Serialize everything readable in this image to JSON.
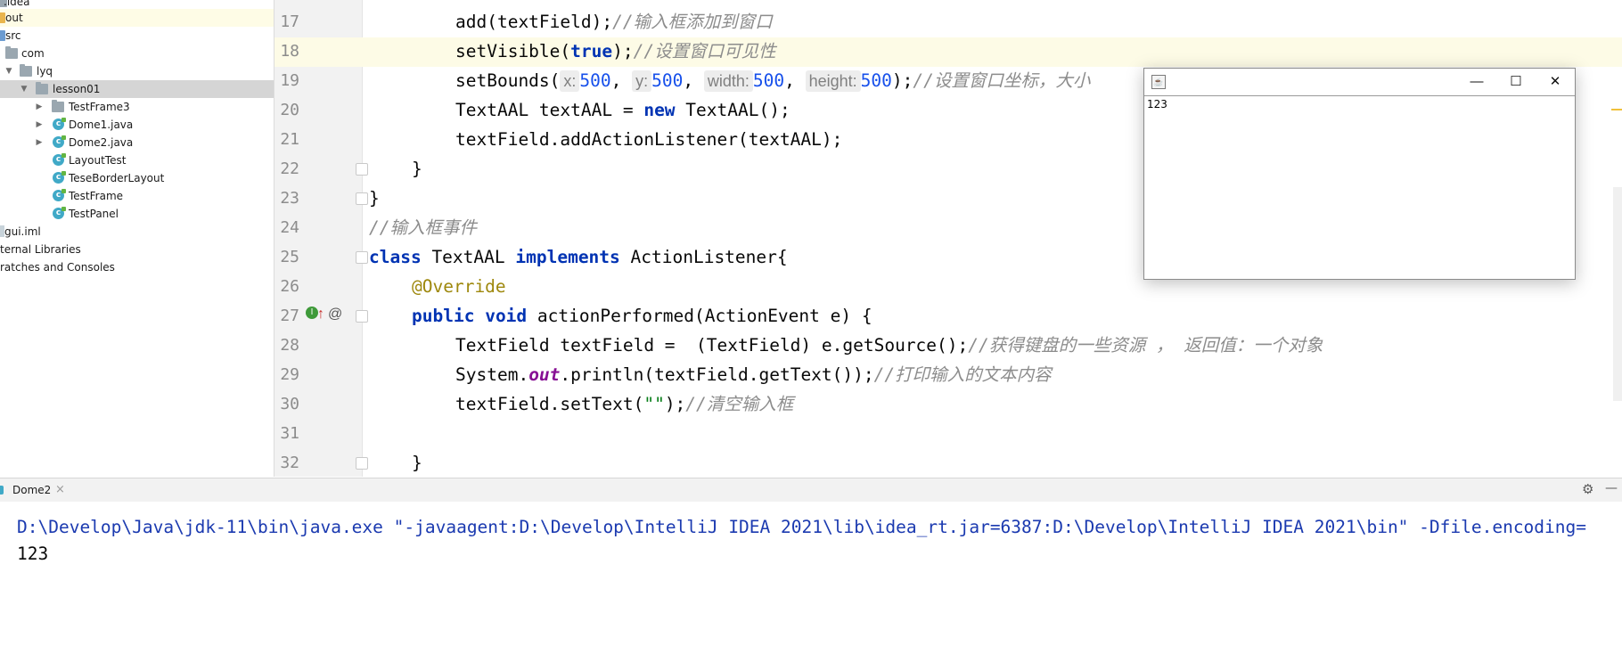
{
  "project_tree": {
    "items": [
      {
        "label": ".idea",
        "kind": "folder"
      },
      {
        "label": "out",
        "kind": "folder"
      },
      {
        "label": "src",
        "kind": "folder"
      },
      {
        "label": "com",
        "kind": "folder"
      },
      {
        "label": "lyq",
        "kind": "folder"
      },
      {
        "label": "lesson01",
        "kind": "folder"
      },
      {
        "label": "TestFrame3",
        "kind": "folder"
      },
      {
        "label": "Dome1.java",
        "kind": "class"
      },
      {
        "label": "Dome2.java",
        "kind": "class"
      },
      {
        "label": "LayoutTest",
        "kind": "class"
      },
      {
        "label": "TeseBorderLayout",
        "kind": "class"
      },
      {
        "label": "TestFrame",
        "kind": "class"
      },
      {
        "label": "TestPanel",
        "kind": "class"
      },
      {
        "label": "gui.iml",
        "kind": "file"
      },
      {
        "label": "ternal Libraries",
        "kind": "none"
      },
      {
        "label": "ratches and Consoles",
        "kind": "none"
      }
    ]
  },
  "editor": {
    "line_numbers": [
      "17",
      "18",
      "19",
      "20",
      "21",
      "22",
      "23",
      "24",
      "25",
      "26",
      "27",
      "28",
      "29",
      "30",
      "31",
      "32"
    ],
    "l17": {
      "code": "add(textField);",
      "comment": "//输入框添加到窗口"
    },
    "l18": {
      "pre": "setVisible(",
      "kw": "true",
      "post": ");",
      "comment": "//设置窗口可见性"
    },
    "l19": {
      "pre": "setBounds(",
      "hint_x": "x:",
      "val_x": "500",
      "hint_y": "y:",
      "val_y": "500",
      "hint_w": "width:",
      "val_w": "500",
      "hint_h": "height:",
      "val_h": "500",
      "post": ");",
      "comment": "//设置窗口坐标，大小"
    },
    "l20": {
      "pre": "TextAAL textAAL = ",
      "kw": "new",
      "post": " TextAAL();"
    },
    "l21": {
      "code": "textField.addActionListener(textAAL);"
    },
    "l22": {
      "code": "}"
    },
    "l23": {
      "code": "}"
    },
    "l24": {
      "comment": "//输入框事件"
    },
    "l25": {
      "kw1": "class",
      "mid": " TextAAL ",
      "kw2": "implements",
      "post": " ActionListener{"
    },
    "l26": {
      "annotation": "@Override"
    },
    "l27": {
      "kw1": "public",
      "kw2": "void",
      "post": " actionPerformed(ActionEvent e) {"
    },
    "l28": {
      "code": "TextField textField =  (TextField) e.getSource();",
      "comment": "//获得键盘的一些资源 ， 返回值：一个对象"
    },
    "l29": {
      "pre": "System.",
      "field": "out",
      "post": ".println(textField.getText());",
      "comment": "//打印输入的文本内容"
    },
    "l30": {
      "pre": "textField.setText(",
      "str": "\"\"",
      "post": ");",
      "comment": "//清空输入框"
    },
    "l32": {
      "code": "}"
    },
    "gutter_icons": {
      "impl": "I",
      "override": "@"
    }
  },
  "swing_window": {
    "icon": "java-icon",
    "minimize": "—",
    "maximize": "☐",
    "close": "✕",
    "text_field_value": "123"
  },
  "run_panel": {
    "tab_label": "Dome2",
    "tab_close": "×",
    "settings_icon": "⚙",
    "hide_icon": "—",
    "console_lines": [
      "D:\\Develop\\Java\\jdk-11\\bin\\java.exe \"-javaagent:D:\\Develop\\IntelliJ IDEA 2021\\lib\\idea_rt.jar=6387:D:\\Develop\\IntelliJ IDEA 2021\\bin\" -Dfile.encoding=",
      "123"
    ],
    "colors": {
      "command": "#1b3ab0",
      "output": "#080808"
    }
  }
}
